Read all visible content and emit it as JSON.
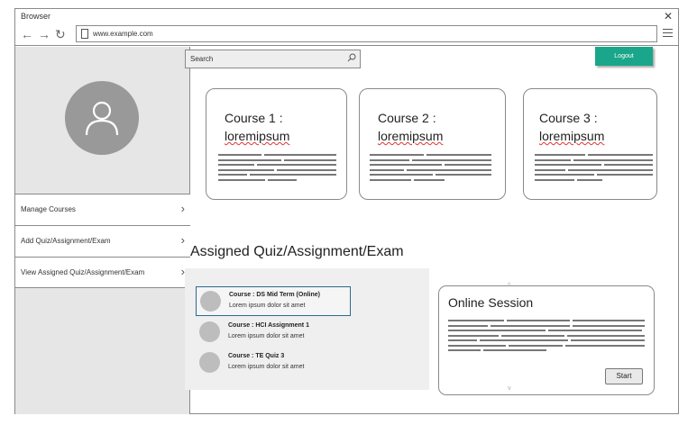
{
  "browser": {
    "title": "Browser",
    "url": "www.example.com"
  },
  "search": {
    "placeholder": "Search"
  },
  "header": {
    "logout_label": "Logout"
  },
  "sidebar": {
    "items": [
      {
        "label": "Manage Courses"
      },
      {
        "label": "Add Quiz/Assignment/Exam"
      },
      {
        "label": "View Assigned Quiz/Assignment/Exam"
      }
    ]
  },
  "courses": [
    {
      "title": "Course 1 :",
      "name": "loremipsum"
    },
    {
      "title": "Course 2 :",
      "name": "loremipsum"
    },
    {
      "title": "Course 3 :",
      "name": "loremipsum"
    }
  ],
  "assigned": {
    "heading": "Assigned Quiz/Assignment/Exam",
    "items": [
      {
        "title": "Course : DS Mid Term (Online)",
        "subtitle": "Lorem ipsum dolor sit amet"
      },
      {
        "title": "Course : HCI Assignment 1",
        "subtitle": "Lorem ipsum dolor sit amet"
      },
      {
        "title": "Course : TE Quiz 3",
        "subtitle": "Lorem ipsum dolor sit amet"
      }
    ]
  },
  "online_session": {
    "title": "Online Session",
    "start_label": "Start"
  },
  "colors": {
    "accent": "#1aa68a",
    "selected_border": "#2a6c8e",
    "sidebar_bg": "#e6e6e6"
  },
  "icons": {
    "back": "arrow-left-icon",
    "forward": "arrow-right-icon",
    "refresh": "refresh-icon",
    "close": "close-icon",
    "menu": "hamburger-menu-icon",
    "search": "search-icon",
    "user": "user-avatar-icon",
    "chevron": "chevron-right-icon"
  }
}
